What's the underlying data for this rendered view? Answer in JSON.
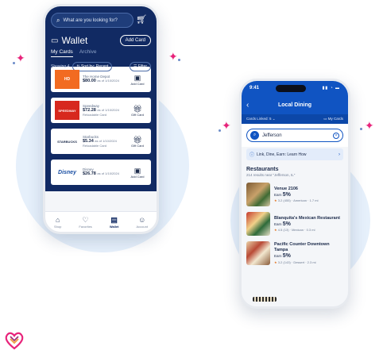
{
  "left_phone": {
    "search_placeholder": "What are you looking for?",
    "wallet_title": "Wallet",
    "add_card_label": "Add Card",
    "tabs": [
      {
        "label": "My Cards",
        "active": true
      },
      {
        "label": "Archive",
        "active": false
      }
    ],
    "filter_bar": {
      "showing": "Showing 4",
      "sort_label": "Sort by:",
      "sort_value": "Recent",
      "filter_label": "Filter"
    },
    "cards": [
      {
        "logo": "HD",
        "logo_color": "#f26b21",
        "name": "The Home Depot",
        "balance": "$80.00",
        "balance_note": "as of 1/10/2024",
        "sub": "",
        "action": "Add Card"
      },
      {
        "logo": "SPEEDWAY",
        "logo_color": "#d7281e",
        "name": "Speedway",
        "balance": "$72.28",
        "balance_note": "as of 1/10/2024",
        "sub": "Reloadable Card",
        "action": "Gift Card"
      },
      {
        "logo": "STARBUCKS",
        "logo_color": "#ffffff",
        "name": "Starbucks",
        "balance": "$5.34",
        "balance_note": "as of 1/10/2024",
        "sub": "Reloadable Card",
        "action": "Gift Card"
      },
      {
        "logo": "Disney",
        "logo_color": "#ffffff",
        "name": "Disney",
        "balance": "$26.78",
        "balance_note": "as of 1/10/2024",
        "sub": "",
        "action": "Add Card"
      }
    ],
    "nav": [
      {
        "label": "Shop",
        "icon": "shop-icon",
        "active": false
      },
      {
        "label": "Favorites",
        "icon": "heart-icon",
        "active": false
      },
      {
        "label": "Wallet",
        "icon": "wallet-icon",
        "active": true
      },
      {
        "label": "Account",
        "icon": "account-icon",
        "active": false
      }
    ]
  },
  "right_phone": {
    "time": "9:41",
    "title": "Local Dining",
    "cards_linked": "Cards Linked: 5",
    "my_cards": "My Cards",
    "search_value": "Jefferson",
    "promo": "Link, Dine, Earn: Learn How",
    "section_title": "Restaurants",
    "results": "214 results near \"Jefferson, IL\"",
    "restaurants": [
      {
        "name": "Venue 2106",
        "earn_label": "Earn",
        "earn": "5%",
        "rating": "3.2",
        "reviews": "(455)",
        "cuisine": "American",
        "distance": "1.7 mi"
      },
      {
        "name": "Blanquita's Mexican Restaurant",
        "earn_label": "Earn",
        "earn": "5%",
        "rating": "4.5",
        "reviews": "(13)",
        "cuisine": "Mexican",
        "distance": "0.3 mi"
      },
      {
        "name": "Pacific Counter Downtown Tampa",
        "earn_label": "Earn",
        "earn": "5%",
        "rating": "3.2",
        "reviews": "(143)",
        "cuisine": "Dessert",
        "distance": "2.3 mi"
      }
    ]
  },
  "colors": {
    "navy": "#112a63",
    "blue": "#1054c2",
    "bg_circle": "#e6f0fb",
    "sparkle_pink": "#e8247b"
  }
}
